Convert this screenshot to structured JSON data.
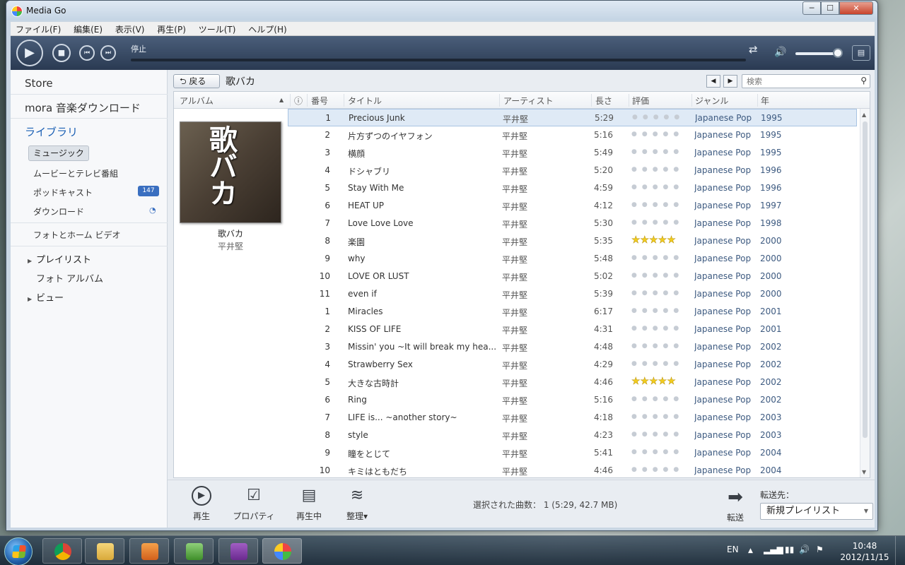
{
  "window": {
    "title": "Media Go",
    "minimize": "─",
    "maximize": "☐",
    "close": "✕"
  },
  "menu": [
    "ファイル(F)",
    "編集(E)",
    "表示(V)",
    "再生(P)",
    "ツール(T)",
    "ヘルプ(H)"
  ],
  "player": {
    "status": "停止",
    "play_icon": "▶",
    "stop_icon": "■",
    "prev_icon": "⏮",
    "next_icon": "⏭",
    "repeat_icon": "⇄",
    "volume_icon": "🔊",
    "volume_level": 0.9,
    "view_icon": "▤"
  },
  "sidebar": {
    "store": "Store",
    "mora": "mora 音楽ダウンロード",
    "library": "ライブラリ",
    "music": "ミュージック",
    "movies": "ムービーとテレビ番組",
    "podcasts": "ポッドキャスト",
    "podcasts_badge": "147",
    "downloads": "ダウンロード",
    "photo_home_video": "フォトとホーム ビデオ",
    "playlists": "プレイリスト",
    "photo_album": "フォト アルバム",
    "views": "ビュー"
  },
  "toolbar": {
    "back": "⮌ 戻る",
    "breadcrumb": "歌バカ",
    "prev_arrow": "◀",
    "next_arrow": "▶",
    "search_placeholder": "検索",
    "search_icon": "⚲"
  },
  "columns": {
    "album": "アルバム",
    "info": "ⓘ",
    "no": "番号",
    "title": "タイトル",
    "artist": "アーティスト",
    "length": "長さ",
    "rating": "評価",
    "genre": "ジャンル",
    "year": "年"
  },
  "album": {
    "name": "歌バカ",
    "artist": "平井堅",
    "cover_text": "歌バカ"
  },
  "tracks": [
    {
      "no": "1",
      "title": "Precious Junk",
      "artist": "平井堅",
      "length": "5:29",
      "rating": 0,
      "genre": "Japanese Pop",
      "year": "1995",
      "selected": true
    },
    {
      "no": "2",
      "title": "片方ずつのイヤフォン",
      "artist": "平井堅",
      "length": "5:16",
      "rating": 0,
      "genre": "Japanese Pop",
      "year": "1995"
    },
    {
      "no": "3",
      "title": "横顔",
      "artist": "平井堅",
      "length": "5:49",
      "rating": 0,
      "genre": "Japanese Pop",
      "year": "1995"
    },
    {
      "no": "4",
      "title": "ドシャブリ",
      "artist": "平井堅",
      "length": "5:20",
      "rating": 0,
      "genre": "Japanese Pop",
      "year": "1996"
    },
    {
      "no": "5",
      "title": "Stay With Me",
      "artist": "平井堅",
      "length": "4:59",
      "rating": 0,
      "genre": "Japanese Pop",
      "year": "1996"
    },
    {
      "no": "6",
      "title": "HEAT UP",
      "artist": "平井堅",
      "length": "4:12",
      "rating": 0,
      "genre": "Japanese Pop",
      "year": "1997"
    },
    {
      "no": "7",
      "title": "Love Love Love",
      "artist": "平井堅",
      "length": "5:30",
      "rating": 0,
      "genre": "Japanese Pop",
      "year": "1998"
    },
    {
      "no": "8",
      "title": "楽園",
      "artist": "平井堅",
      "length": "5:35",
      "rating": 5,
      "genre": "Japanese Pop",
      "year": "2000"
    },
    {
      "no": "9",
      "title": "why",
      "artist": "平井堅",
      "length": "5:48",
      "rating": 0,
      "genre": "Japanese Pop",
      "year": "2000"
    },
    {
      "no": "10",
      "title": "LOVE OR LUST",
      "artist": "平井堅",
      "length": "5:02",
      "rating": 0,
      "genre": "Japanese Pop",
      "year": "2000"
    },
    {
      "no": "11",
      "title": "even if",
      "artist": "平井堅",
      "length": "5:39",
      "rating": 0,
      "genre": "Japanese Pop",
      "year": "2000"
    },
    {
      "no": "1",
      "title": "Miracles",
      "artist": "平井堅",
      "length": "6:17",
      "rating": 0,
      "genre": "Japanese Pop",
      "year": "2001"
    },
    {
      "no": "2",
      "title": "KISS OF LIFE",
      "artist": "平井堅",
      "length": "4:31",
      "rating": 0,
      "genre": "Japanese Pop",
      "year": "2001"
    },
    {
      "no": "3",
      "title": "Missin' you ~It will break my hea...",
      "artist": "平井堅",
      "length": "4:48",
      "rating": 0,
      "genre": "Japanese Pop",
      "year": "2002"
    },
    {
      "no": "4",
      "title": "Strawberry Sex",
      "artist": "平井堅",
      "length": "4:29",
      "rating": 0,
      "genre": "Japanese Pop",
      "year": "2002"
    },
    {
      "no": "5",
      "title": "大きな古時計",
      "artist": "平井堅",
      "length": "4:46",
      "rating": 5,
      "genre": "Japanese Pop",
      "year": "2002"
    },
    {
      "no": "6",
      "title": "Ring",
      "artist": "平井堅",
      "length": "5:16",
      "rating": 0,
      "genre": "Japanese Pop",
      "year": "2002"
    },
    {
      "no": "7",
      "title": "LIFE is... ~another story~",
      "artist": "平井堅",
      "length": "4:18",
      "rating": 0,
      "genre": "Japanese Pop",
      "year": "2003"
    },
    {
      "no": "8",
      "title": "style",
      "artist": "平井堅",
      "length": "4:23",
      "rating": 0,
      "genre": "Japanese Pop",
      "year": "2003"
    },
    {
      "no": "9",
      "title": "瞳をとじて",
      "artist": "平井堅",
      "length": "5:41",
      "rating": 0,
      "genre": "Japanese Pop",
      "year": "2004"
    },
    {
      "no": "10",
      "title": "キミはともだち",
      "artist": "平井堅",
      "length": "4:46",
      "rating": 0,
      "genre": "Japanese Pop",
      "year": "2004"
    }
  ],
  "bottom": {
    "play": "再生",
    "properties": "プロパティ",
    "now_playing": "再生中",
    "organize": "整理▾",
    "selection_info": "選択された曲数： 1 (5:29, 42.7 MB)",
    "transfer": "転送",
    "transfer_to": "転送先：",
    "destination": "新規プレイリスト"
  },
  "taskbar": {
    "lang": "EN",
    "time": "10:48",
    "date": "2012/11/15"
  },
  "colors": {
    "accent": "#1a5fb4",
    "player_bg": "#3a4e68",
    "star": "#f2cc1e"
  }
}
